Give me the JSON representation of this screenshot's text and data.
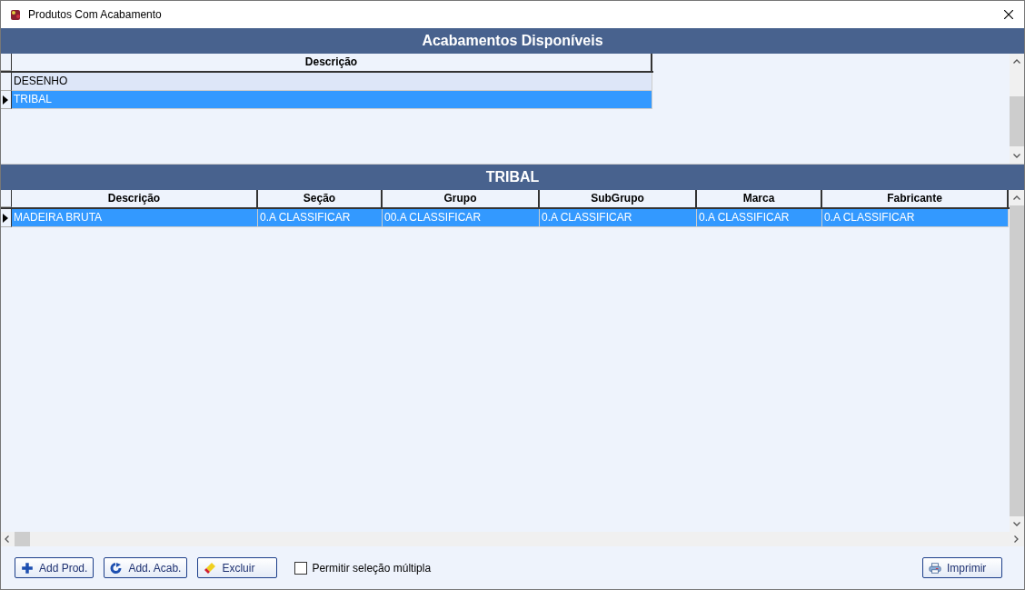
{
  "window": {
    "title": "Produtos Com Acabamento"
  },
  "finishes_panel": {
    "title": "Acabamentos Disponíveis",
    "columns": [
      "Descrição"
    ],
    "rows": [
      {
        "cells": [
          "DESENHO"
        ],
        "selected": false
      },
      {
        "cells": [
          "TRIBAL"
        ],
        "selected": true
      }
    ]
  },
  "products_panel": {
    "title": "TRIBAL",
    "columns": [
      "Descrição",
      "Seção",
      "Grupo",
      "SubGrupo",
      "Marca",
      "Fabricante"
    ],
    "rows": [
      {
        "cells": [
          "MADEIRA BRUTA",
          "0.A CLASSIFICAR",
          "00.A CLASSIFICAR",
          "0.A CLASSIFICAR",
          "0.A CLASSIFICAR",
          "0.A CLASSIFICAR"
        ],
        "selected": true
      }
    ]
  },
  "buttons": [
    {
      "kind": "plus",
      "label": "Add Prod."
    },
    {
      "kind": "refresh",
      "label": "Add. Acab."
    },
    {
      "kind": "eraser",
      "label": "Excluir"
    }
  ],
  "multi_select": {
    "label": "Permitir seleção múltipla",
    "checked": false
  },
  "print_button": {
    "kind": "printer",
    "label": "Imprimir"
  }
}
